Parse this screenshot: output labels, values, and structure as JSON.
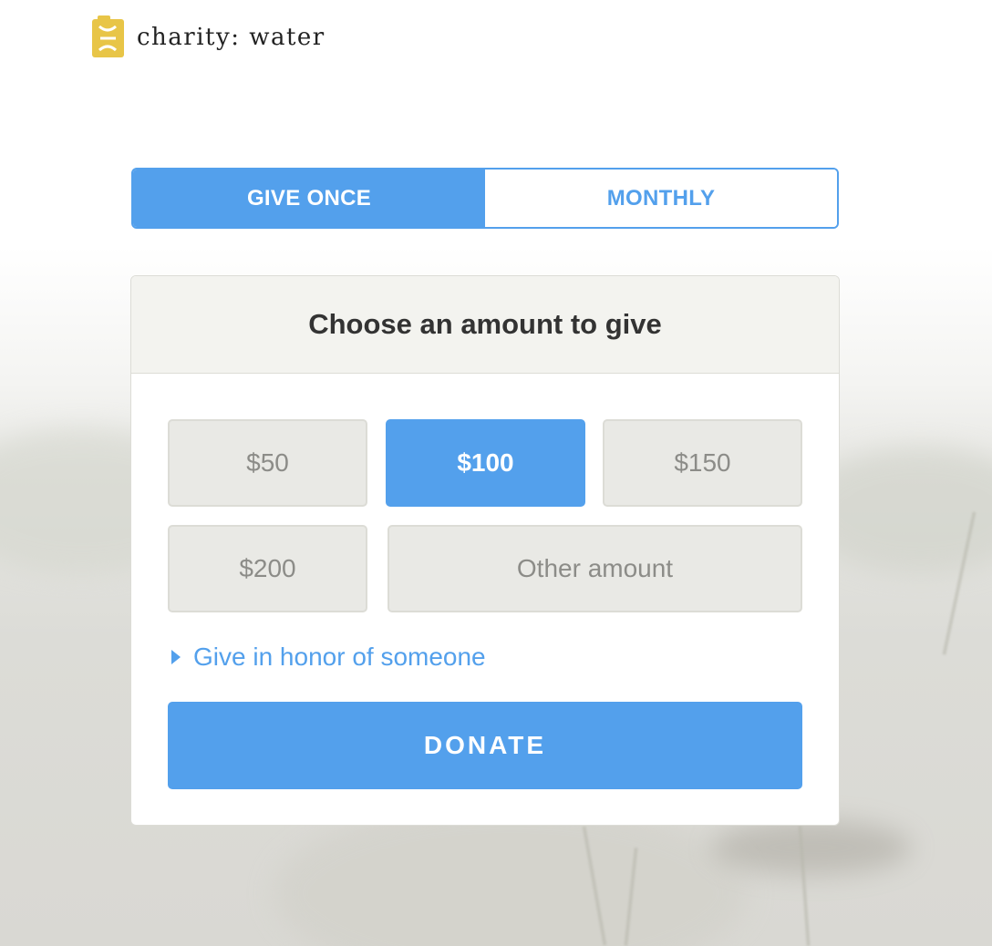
{
  "header": {
    "logo_text": "charity: water",
    "logo_icon": "jerry-can-icon",
    "logo_color": "#e8c547"
  },
  "frequency": {
    "options": [
      {
        "label": "GIVE ONCE",
        "selected": true
      },
      {
        "label": "MONTHLY",
        "selected": false
      }
    ]
  },
  "card": {
    "title": "Choose an amount to give",
    "amounts": [
      {
        "label": "$50",
        "selected": false
      },
      {
        "label": "$100",
        "selected": true
      },
      {
        "label": "$150",
        "selected": false
      },
      {
        "label": "$200",
        "selected": false
      }
    ],
    "other_amount_placeholder": "Other amount",
    "honor_link": "Give in honor of someone",
    "donate_label": "DONATE"
  },
  "colors": {
    "accent": "#53a0ec",
    "header_bg": "#f3f3ef",
    "amount_bg": "#e9e9e5",
    "amount_text": "#8c8c88",
    "title_text": "#333333"
  }
}
